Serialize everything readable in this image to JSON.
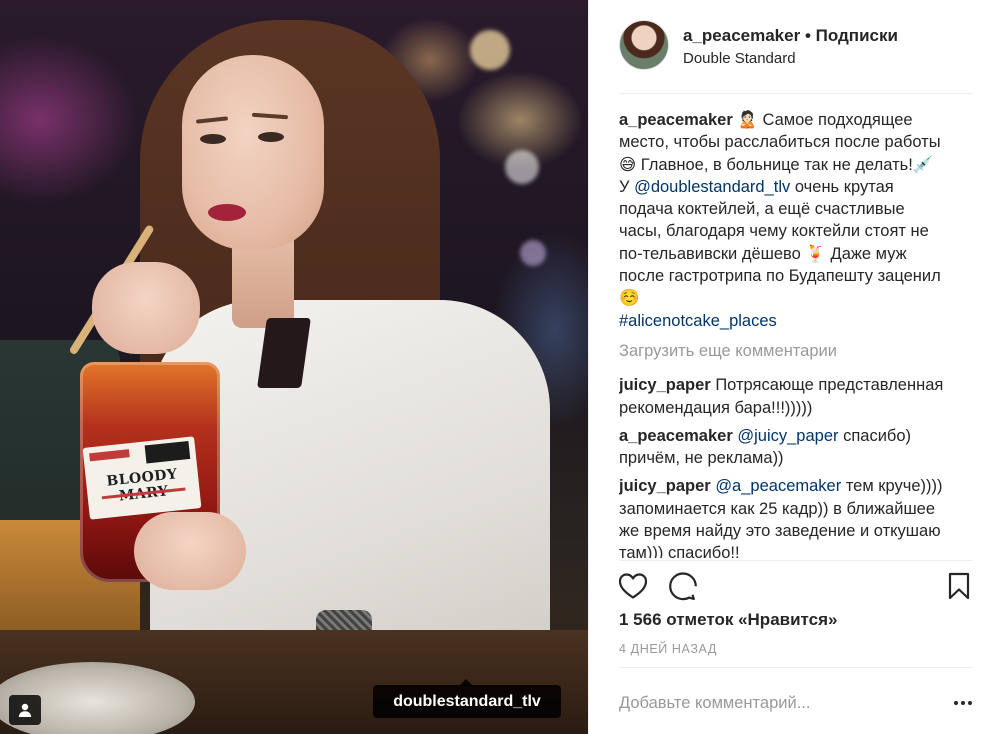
{
  "photo": {
    "bag_label_text": "BLOODY MARY",
    "tag_label": "doublestandard_tlv"
  },
  "header": {
    "username": "a_peacemaker",
    "separator": "•",
    "follow_label": "Подписки",
    "location": "Double Standard"
  },
  "caption": {
    "username": "a_peacemaker",
    "lines": [
      "🙎🏻 Самое подходящее",
      "место, чтобы расслабиться после работы",
      "😅 Главное, в больнице так не делать!💉",
      "У ",
      "очень крутая",
      "подача коктейлей, а ещё счастливые",
      "часы, благодаря чему коктейли стоят не",
      "по-тельавивски дёшево 🍹 Даже муж",
      "после гастротрипа по Будапешту заценил",
      "☺️"
    ],
    "mention": "@doublestandard_tlv",
    "hashtag": "#alicenotcake_places"
  },
  "load_more_label": "Загрузить еще комментарии",
  "comments": [
    {
      "username": "juicy_paper",
      "first": "Потрясающе представленная",
      "rest": [
        "рекомендация бара!!!)))))"
      ]
    },
    {
      "username": "a_peacemaker",
      "mention": "@juicy_paper",
      "first": "спасибо)",
      "rest": [
        "причём, не реклама))"
      ]
    },
    {
      "username": "juicy_paper",
      "mention": "@a_peacemaker",
      "first": "тем круче))))",
      "rest": [
        "запоминается как 25 кадр)) в ближайшее",
        "же время найду это заведение и откушаю",
        "там))) спасибо!!"
      ]
    }
  ],
  "actions": {
    "like_icon": "heart-outline-icon",
    "comment_icon": "speech-bubble-icon",
    "save_icon": "bookmark-icon"
  },
  "likes_label": "1 566 отметок «Нравится»",
  "timestamp": "4 ДНЕЙ НАЗАД",
  "add_comment_placeholder": "Добавьте комментарий...",
  "colors": {
    "text": "#262626",
    "muted": "#999999",
    "link": "#003569",
    "border": "#efefef"
  }
}
